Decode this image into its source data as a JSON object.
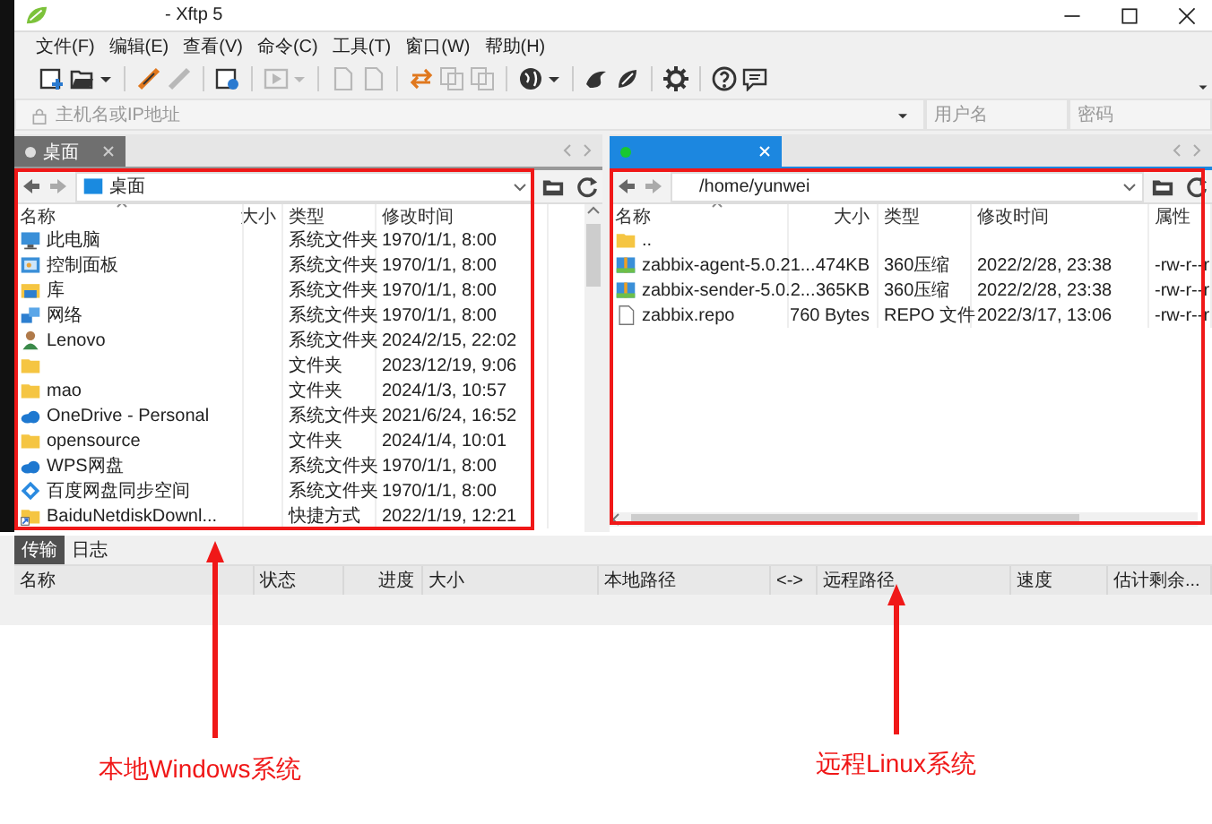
{
  "window": {
    "title": "- Xftp 5"
  },
  "menu": [
    "文件(F)",
    "编辑(E)",
    "查看(V)",
    "命令(C)",
    "工具(T)",
    "窗口(W)",
    "帮助(H)"
  ],
  "toolbar": [
    {
      "kind": "new",
      "disabled": false,
      "dropdown": false
    },
    {
      "kind": "open",
      "disabled": false,
      "dropdown": true
    },
    {
      "kind": "sep"
    },
    {
      "kind": "connect",
      "disabled": false,
      "dropdown": false
    },
    {
      "kind": "disconnect",
      "disabled": true,
      "dropdown": false
    },
    {
      "kind": "sep"
    },
    {
      "kind": "properties",
      "disabled": false,
      "dropdown": false
    },
    {
      "kind": "sep"
    },
    {
      "kind": "play",
      "disabled": true,
      "dropdown": true
    },
    {
      "kind": "sep"
    },
    {
      "kind": "page",
      "disabled": true,
      "dropdown": false
    },
    {
      "kind": "page",
      "disabled": true,
      "dropdown": false
    },
    {
      "kind": "sep"
    },
    {
      "kind": "transfer",
      "disabled": false,
      "dropdown": false
    },
    {
      "kind": "copy",
      "disabled": true,
      "dropdown": false
    },
    {
      "kind": "copy",
      "disabled": true,
      "dropdown": false
    },
    {
      "kind": "sep"
    },
    {
      "kind": "globe",
      "disabled": false,
      "dropdown": true
    },
    {
      "kind": "sep"
    },
    {
      "kind": "swirl",
      "disabled": false,
      "dropdown": false
    },
    {
      "kind": "leaf",
      "disabled": false,
      "dropdown": false
    },
    {
      "kind": "sep"
    },
    {
      "kind": "settings",
      "disabled": false,
      "dropdown": false
    },
    {
      "kind": "sep"
    },
    {
      "kind": "help",
      "disabled": false,
      "dropdown": false
    },
    {
      "kind": "chat",
      "disabled": false,
      "dropdown": false
    }
  ],
  "connection": {
    "host_placeholder": "主机名或IP地址",
    "username_placeholder": "用户名",
    "password_placeholder": "密码"
  },
  "session_tabs": [
    {
      "label": "桌面",
      "selected": false,
      "connected": false
    },
    {
      "selected": true,
      "connected": true
    }
  ],
  "local_pane": {
    "path": "桌面",
    "columns": [
      "名称",
      "大小",
      "类型",
      "修改时间"
    ],
    "rows": [
      {
        "kind": "computer",
        "name": "此电脑",
        "type": "系统文件夹",
        "modified": "1970/1/1, 8:00"
      },
      {
        "kind": "control",
        "name": "控制面板",
        "type": "系统文件夹",
        "modified": "1970/1/1, 8:00"
      },
      {
        "kind": "library",
        "name": "库",
        "type": "系统文件夹",
        "modified": "1970/1/1, 8:00"
      },
      {
        "kind": "network",
        "name": "网络",
        "type": "系统文件夹",
        "modified": "1970/1/1, 8:00"
      },
      {
        "kind": "user",
        "name": "Lenovo",
        "type": "系统文件夹",
        "modified": "2024/2/15, 22:02"
      },
      {
        "kind": "folder",
        "type": "文件夹",
        "modified": "2023/12/19, 9:06"
      },
      {
        "kind": "folder",
        "name": "mao",
        "type": "文件夹",
        "modified": "2024/1/3, 10:57"
      },
      {
        "kind": "cloud",
        "name": "OneDrive - Personal",
        "type": "系统文件夹",
        "modified": "2021/6/24, 16:52"
      },
      {
        "kind": "folder",
        "name": "opensource",
        "type": "文件夹",
        "modified": "2024/1/4, 10:01"
      },
      {
        "kind": "cloud",
        "name": "WPS网盘",
        "type": "系统文件夹",
        "modified": "1970/1/1, 8:00"
      },
      {
        "kind": "diamond",
        "name": "百度网盘同步空间",
        "type": "系统文件夹",
        "modified": "1970/1/1, 8:00"
      },
      {
        "kind": "shortcut",
        "name": "BaiduNetdiskDownl...",
        "type": "快捷方式",
        "modified": "2022/1/19, 12:21"
      }
    ]
  },
  "remote_pane": {
    "path": "/home/yunwei",
    "columns": [
      "名称",
      "大小",
      "类型",
      "修改时间",
      "属性"
    ],
    "rows": [
      {
        "kind": "folder",
        "name": ".."
      },
      {
        "kind": "archive",
        "name": "zabbix-agent-5.0.21...",
        "size": "474KB",
        "type": "360压缩",
        "modified": "2022/2/28, 23:38",
        "attributes": "-rw-r--r"
      },
      {
        "kind": "archive",
        "name": "zabbix-sender-5.0.2...",
        "size": "365KB",
        "type": "360压缩",
        "modified": "2022/2/28, 23:38",
        "attributes": "-rw-r--r"
      },
      {
        "kind": "file",
        "name": "zabbix.repo",
        "size": "760 Bytes",
        "type": "REPO 文件",
        "modified": "2022/3/17, 13:06",
        "attributes": "-rw-r--r"
      }
    ]
  },
  "bottom_tabs": [
    {
      "label": "传输",
      "selected": true
    },
    {
      "label": "日志",
      "selected": false
    }
  ],
  "transfer_columns": [
    "名称",
    "状态",
    "进度",
    "大小",
    "本地路径",
    "<->",
    "远程路径",
    "速度",
    "估计剩余..."
  ],
  "annotations": [
    {
      "text": "本地Windows系统"
    },
    {
      "text": "远程Linux系统"
    }
  ]
}
